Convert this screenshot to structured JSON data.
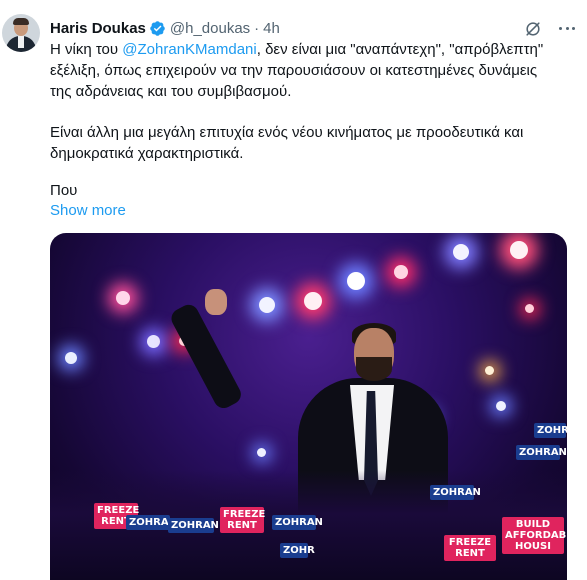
{
  "tweet": {
    "author_name": "Haris Doukas",
    "handle": "@h_doukas",
    "separator": "·",
    "time": "4h",
    "lines": [
      {
        "before": "Η νίκη του ",
        "mention": "@ZohranKMamdani",
        "after": ", δεν είναι μια \"αναπάντεχη\", \"απρόβλεπτη\""
      },
      {
        "text": "εξέλιξη, όπως επιχειρούν να την παρουσιάσουν οι κατεστημένες δυνάμεις"
      },
      {
        "text": "της αδράνειας και του συμβιβασμού."
      },
      {
        "text": "Είναι άλλη μια μεγάλη επιτυχία ενός νέου κινήματος με προοδευτικά και"
      },
      {
        "text": "δημοκρατικά χαρακτηριστικά."
      },
      {
        "text": "Που"
      }
    ],
    "show_more": "Show more"
  },
  "icons": {
    "verified": "verified-badge-icon",
    "grok": "grok-icon",
    "more": "more-options-icon"
  },
  "media": {
    "signs": [
      {
        "text": "FREEZE\nRENT",
        "bg": "#e0245e"
      },
      {
        "text": "ZOHRAN",
        "bg": "#1a3d8f"
      },
      {
        "text": "ZOHRAN",
        "bg": "#1a3d8f"
      },
      {
        "text": "FREEZE\nRENT",
        "bg": "#e0245e"
      },
      {
        "text": "ZOHRAN",
        "bg": "#1a3d8f"
      },
      {
        "text": "ZOHR",
        "bg": "#1a3d8f"
      },
      {
        "text": "ZOHRAN",
        "bg": "#1a3d8f"
      },
      {
        "text": "FREEZE\nRENT",
        "bg": "#e0245e"
      },
      {
        "text": "BUILD\nAFFORDABLE\nHOUSI",
        "bg": "#e0245e"
      },
      {
        "text": "ZOHR",
        "bg": "#1a3d8f"
      },
      {
        "text": "ZOHRAN",
        "bg": "#1a3d8f"
      }
    ]
  },
  "colors": {
    "link": "#1d9bf0",
    "muted": "#536471",
    "text": "#0f1419"
  }
}
